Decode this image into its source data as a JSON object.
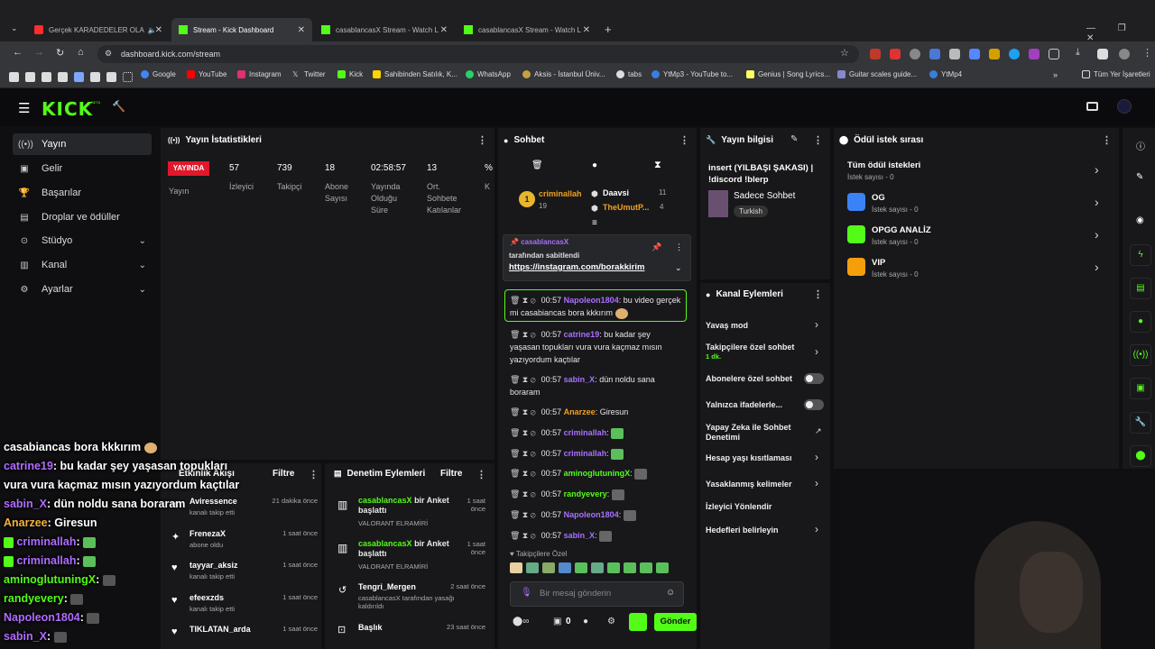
{
  "browser": {
    "tabs": [
      {
        "label": "Gerçek KARADEDELER OLA",
        "color": "#ff2d2d"
      },
      {
        "label": "Stream - Kick Dashboard",
        "color": "#53fc18"
      },
      {
        "label": "casablancasX Stream - Watch L",
        "color": "#53fc18"
      },
      {
        "label": "casablancasX Stream - Watch L",
        "color": "#53fc18"
      }
    ],
    "url": "dashboard.kick.com/stream",
    "bookmarks": [
      {
        "label": "Google",
        "color": "#4285f4"
      },
      {
        "label": "YouTube",
        "color": "#ff0000"
      },
      {
        "label": "Instagram",
        "color": "#e1306c"
      },
      {
        "label": "Twitter",
        "color": "#aaaaaa"
      },
      {
        "label": "Kick",
        "color": "#53fc18"
      },
      {
        "label": "Sahibinden Satılık, K...",
        "color": "#ffd400"
      },
      {
        "label": "WhatsApp",
        "color": "#25d366"
      },
      {
        "label": "Aksis - İstanbul Üniv...",
        "color": "#c8a040"
      },
      {
        "label": "tabs",
        "color": "#dddddd"
      },
      {
        "label": "YtMp3 - YouTube to...",
        "color": "#3b7ddd"
      },
      {
        "label": "Genius | Song Lyrics...",
        "color": "#ffff64"
      },
      {
        "label": "Guitar scales guide...",
        "color": "#8888cc"
      },
      {
        "label": "YtMp4",
        "color": "#3b7ddd"
      }
    ],
    "all_bookmarks": "Tüm Yer İşaretleri"
  },
  "app": {
    "logo": "KICK",
    "beta": "BETA"
  },
  "sidebar": [
    {
      "label": "Yayın",
      "icon": "broadcast-icon"
    },
    {
      "label": "Gelir",
      "icon": "revenue-icon"
    },
    {
      "label": "Başarılar",
      "icon": "trophy-icon"
    },
    {
      "label": "Droplar ve ödüller",
      "icon": "gift-icon"
    },
    {
      "label": "Stüdyo",
      "icon": "studio-icon"
    },
    {
      "label": "Kanal",
      "icon": "channel-icon"
    },
    {
      "label": "Ayarlar",
      "icon": "settings-icon"
    }
  ],
  "stats": {
    "title": "Yayın İstatistikleri",
    "live_badge": "YAYINDA",
    "items": [
      {
        "value": "57",
        "label": "İzleyici"
      },
      {
        "value": "739",
        "label": "Takipçi"
      },
      {
        "value": "18",
        "label": "Abone Sayısı"
      },
      {
        "value": "02:58:57",
        "label": "Yayında Olduğu Süre"
      },
      {
        "value": "13",
        "label": "Ort. Sohbete Katılanlar"
      },
      {
        "value": "%",
        "label": "K"
      }
    ],
    "first_label": "Yayın"
  },
  "chat": {
    "title": "Sohbet",
    "leaders": [
      {
        "rank": "1",
        "name": "criminallah",
        "count": "19"
      },
      {
        "rank": "",
        "name": "Daavsi",
        "count": "11"
      },
      {
        "rank": "",
        "name": "TheUmutP...",
        "count": "4"
      }
    ],
    "pinned": {
      "by": "casablancasX",
      "text": "tarafından sabitlendi",
      "link": "https://instagram.com/borakkirim"
    },
    "messages": [
      {
        "time": "00:57",
        "user": "Napoleon1804",
        "text": ": bu video gerçek mi casabiancas bora kkkırım",
        "color": "purple"
      },
      {
        "time": "00:57",
        "user": "catrine19",
        "text": ": bu kadar şey yaşasan topukları vura vura kaçmaz mısın yazıyordum kaçtılar",
        "color": "purple"
      },
      {
        "time": "00:57",
        "user": "sabin_X",
        "text": ": dün noldu sana boraram",
        "color": "purple"
      },
      {
        "time": "00:57",
        "user": "Anarzee",
        "text": ": Giresun",
        "color": "orange"
      },
      {
        "time": "00:57",
        "user": "criminallah",
        "text": ":",
        "color": "purple"
      },
      {
        "time": "00:57",
        "user": "criminallah",
        "text": ":",
        "color": "purple"
      },
      {
        "time": "00:57",
        "user": "aminoglutuningX",
        "text": ":",
        "color": "green"
      },
      {
        "time": "00:57",
        "user": "randyevery",
        "text": ":",
        "color": "green"
      },
      {
        "time": "00:57",
        "user": "Napoleon1804",
        "text": ":",
        "color": "purple"
      },
      {
        "time": "00:57",
        "user": "sabin_X",
        "text": ":",
        "color": "purple"
      }
    ],
    "follower_only": "Takipçilere Özel",
    "input_placeholder": "Bir mesaj gönderin",
    "send": "Gönder",
    "count": "0"
  },
  "stream_info": {
    "title": "Yayın bilgisi",
    "stream_title": "insert (YILBAŞI ŞAKASI) | !discord !blerp",
    "category": "Sadece Sohbet",
    "tag": "Turkish"
  },
  "channel_actions": {
    "title": "Kanal Eylemleri",
    "items": [
      {
        "label": "Yavaş mod",
        "sub": "",
        "type": "chevron"
      },
      {
        "label": "Takipçilere özel sohbet",
        "sub": "1 dk.",
        "type": "chevron"
      },
      {
        "label": "Abonelere özel sohbet",
        "sub": "",
        "type": "toggle"
      },
      {
        "label": "Yalnızca ifadelerle...",
        "sub": "",
        "type": "toggle"
      },
      {
        "label": "Yapay Zeka ile Sohbet Denetimi",
        "sub": "",
        "type": "external"
      },
      {
        "label": "Hesap yaşı kısıtlaması",
        "sub": "",
        "type": "chevron"
      },
      {
        "label": "Yasaklanmış kelimeler",
        "sub": "",
        "type": "chevron"
      },
      {
        "label": "İzleyici Yönlendir",
        "sub": "",
        "type": "none"
      },
      {
        "label": "Hedefleri belirleyin",
        "sub": "",
        "type": "chevron"
      }
    ]
  },
  "rewards": {
    "title": "Ödül istek sırası",
    "items": [
      {
        "label": "Tüm ödül istekleri",
        "sub": "İstek sayısı - 0",
        "color": ""
      },
      {
        "label": "OG",
        "sub": "İstek sayısı - 0",
        "color": "#3b82f6"
      },
      {
        "label": "OPGG ANALİZ",
        "sub": "İstek sayısı - 0",
        "color": "#53fc18"
      },
      {
        "label": "VIP",
        "sub": "İstek sayısı - 0",
        "color": "#f59e0b"
      }
    ]
  },
  "activity": {
    "title": "Etkinlik Akışı",
    "filter": "Filtre",
    "items": [
      {
        "name": "Aviressence",
        "sub": "kanalı takip etti",
        "time": "21 dakika önce"
      },
      {
        "name": "FrenezaX",
        "sub": "abone oldu",
        "time": "1 saat önce"
      },
      {
        "name": "tayyar_aksiz",
        "sub": "kanalı takip etti",
        "time": "1 saat önce"
      },
      {
        "name": "efeexzds",
        "sub": "kanalı takip etti",
        "time": "1 saat önce"
      },
      {
        "name": "TIKLATAN_arda",
        "sub": "",
        "time": "1 saat önce"
      }
    ]
  },
  "moderation": {
    "title": "Denetim Eylemleri",
    "filter": "Filtre",
    "items": [
      {
        "name": "casablancasX",
        "action": "bir Anket başlattı",
        "sub": "VALORANT ELRAMİRİ",
        "time": "1 saat önce"
      },
      {
        "name": "casablancasX",
        "action": "bir Anket başlattı",
        "sub": "VALORANT ELRAMİRİ",
        "time": "1 saat önce"
      },
      {
        "name": "Tengri_Mergen",
        "action": "",
        "sub": "casablancasX tarafından yasağı kaldırıldı",
        "time": "2 saat önce"
      },
      {
        "name": "Başlık",
        "action": "",
        "sub": "",
        "time": "23 saat önce"
      }
    ]
  },
  "overlay": [
    {
      "user": "casabiancas bora kkkırım",
      "text": "",
      "color": "white"
    },
    {
      "user": "catrine19",
      "text": ":  bu kadar şey yaşasan topukları",
      "color": "purple"
    },
    {
      "user": "",
      "text": "vura vura kaçmaz mısın yazıyordum kaçtılar",
      "color": "white"
    },
    {
      "user": "sabin_X",
      "text": ":  dün noldu sana boraram",
      "color": "purple"
    },
    {
      "user": "Anarzee",
      "text": ":  Giresun",
      "color": "orange"
    },
    {
      "user": "criminallah",
      "text": ":",
      "color": "purple"
    },
    {
      "user": "criminallah",
      "text": ":",
      "color": "purple"
    },
    {
      "user": "aminoglutuningX",
      "text": ":",
      "color": "green"
    },
    {
      "user": "randyevery",
      "text": ":",
      "color": "green"
    },
    {
      "user": "Napoleon1804",
      "text": ":",
      "color": "purple"
    },
    {
      "user": "sabin_X",
      "text": ":",
      "color": "purple"
    }
  ]
}
